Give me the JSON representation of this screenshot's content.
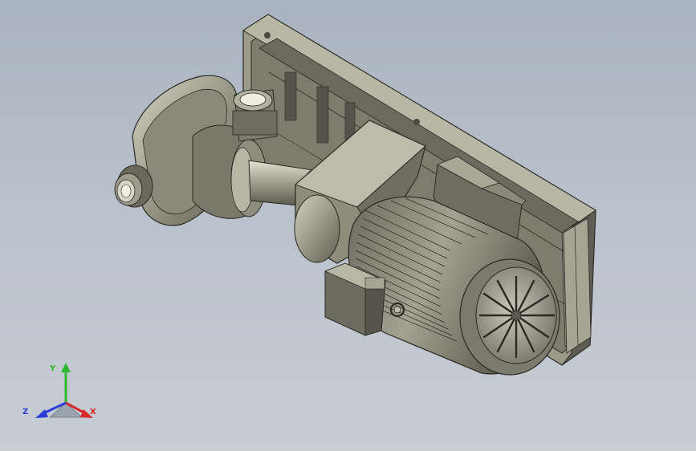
{
  "viewport": {
    "background_top": "#a9b3bf",
    "background_bottom": "#c8cdd4"
  },
  "model": {
    "body_color": "#8e8d7c",
    "body_dark": "#5e5d50",
    "body_light": "#c4c3b2",
    "edge_color": "#2a2a24"
  },
  "triad": {
    "x_label": "X",
    "y_label": "Y",
    "z_label": "Z",
    "x_color": "#d62828",
    "y_color": "#2eb82e",
    "z_color": "#2b3fd6"
  }
}
